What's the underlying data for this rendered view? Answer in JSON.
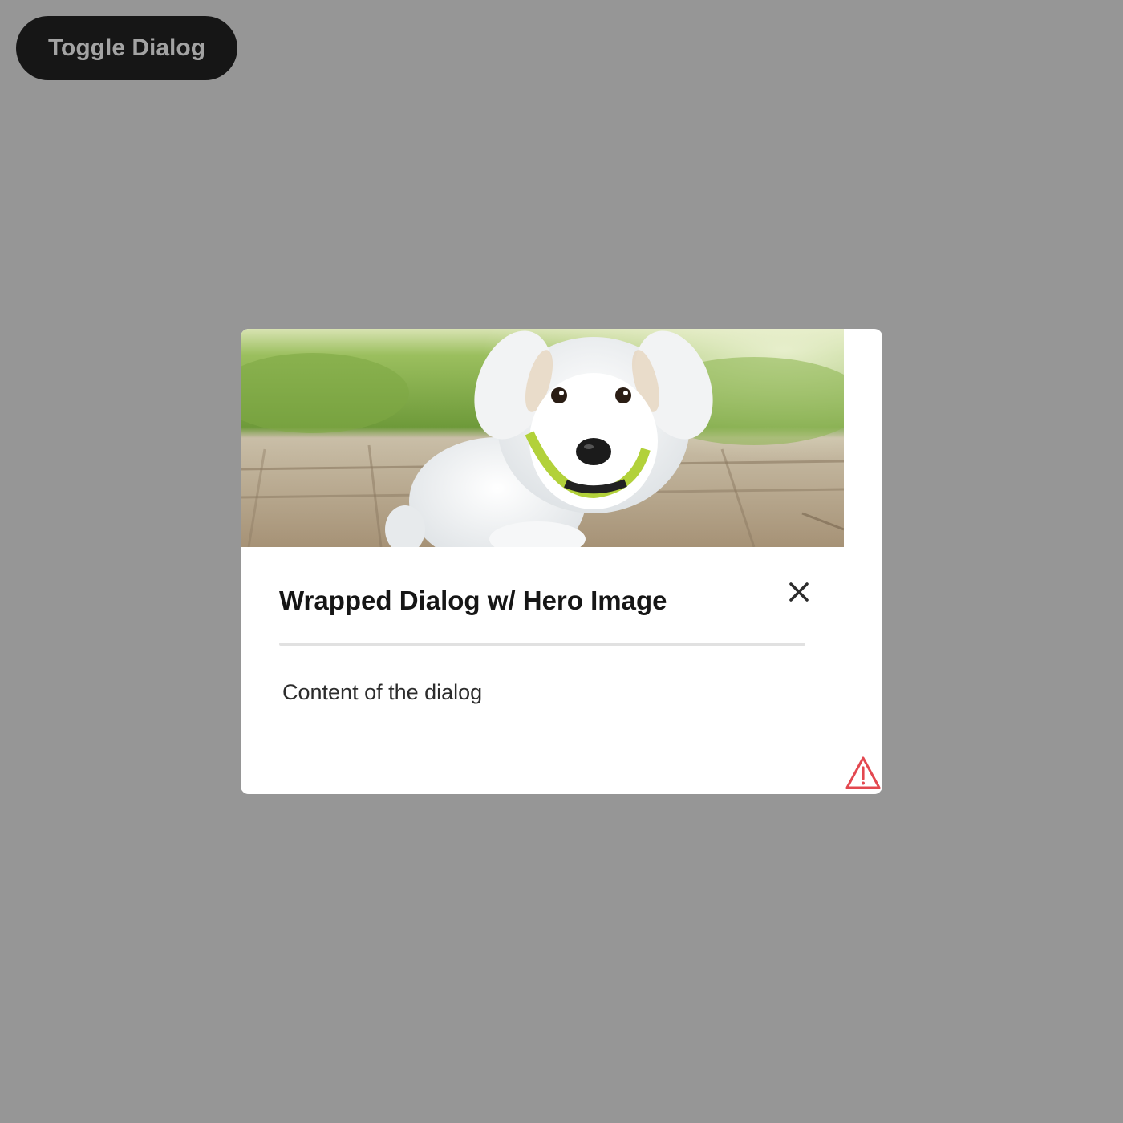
{
  "toggle_button": {
    "label": "Toggle Dialog"
  },
  "dialog": {
    "hero_image": {
      "alt": "white puppy with green collar"
    },
    "title": "Wrapped Dialog w/ Hero Image",
    "content": "Content of the dialog",
    "close_icon": "close-icon",
    "alert_icon": "alert-triangle-icon"
  },
  "colors": {
    "backdrop": "#969696",
    "button_bg": "#161616",
    "button_text": "#a3a3a3",
    "dialog_bg": "#ffffff",
    "divider": "#e1e1e1",
    "alert": "#e34850"
  }
}
